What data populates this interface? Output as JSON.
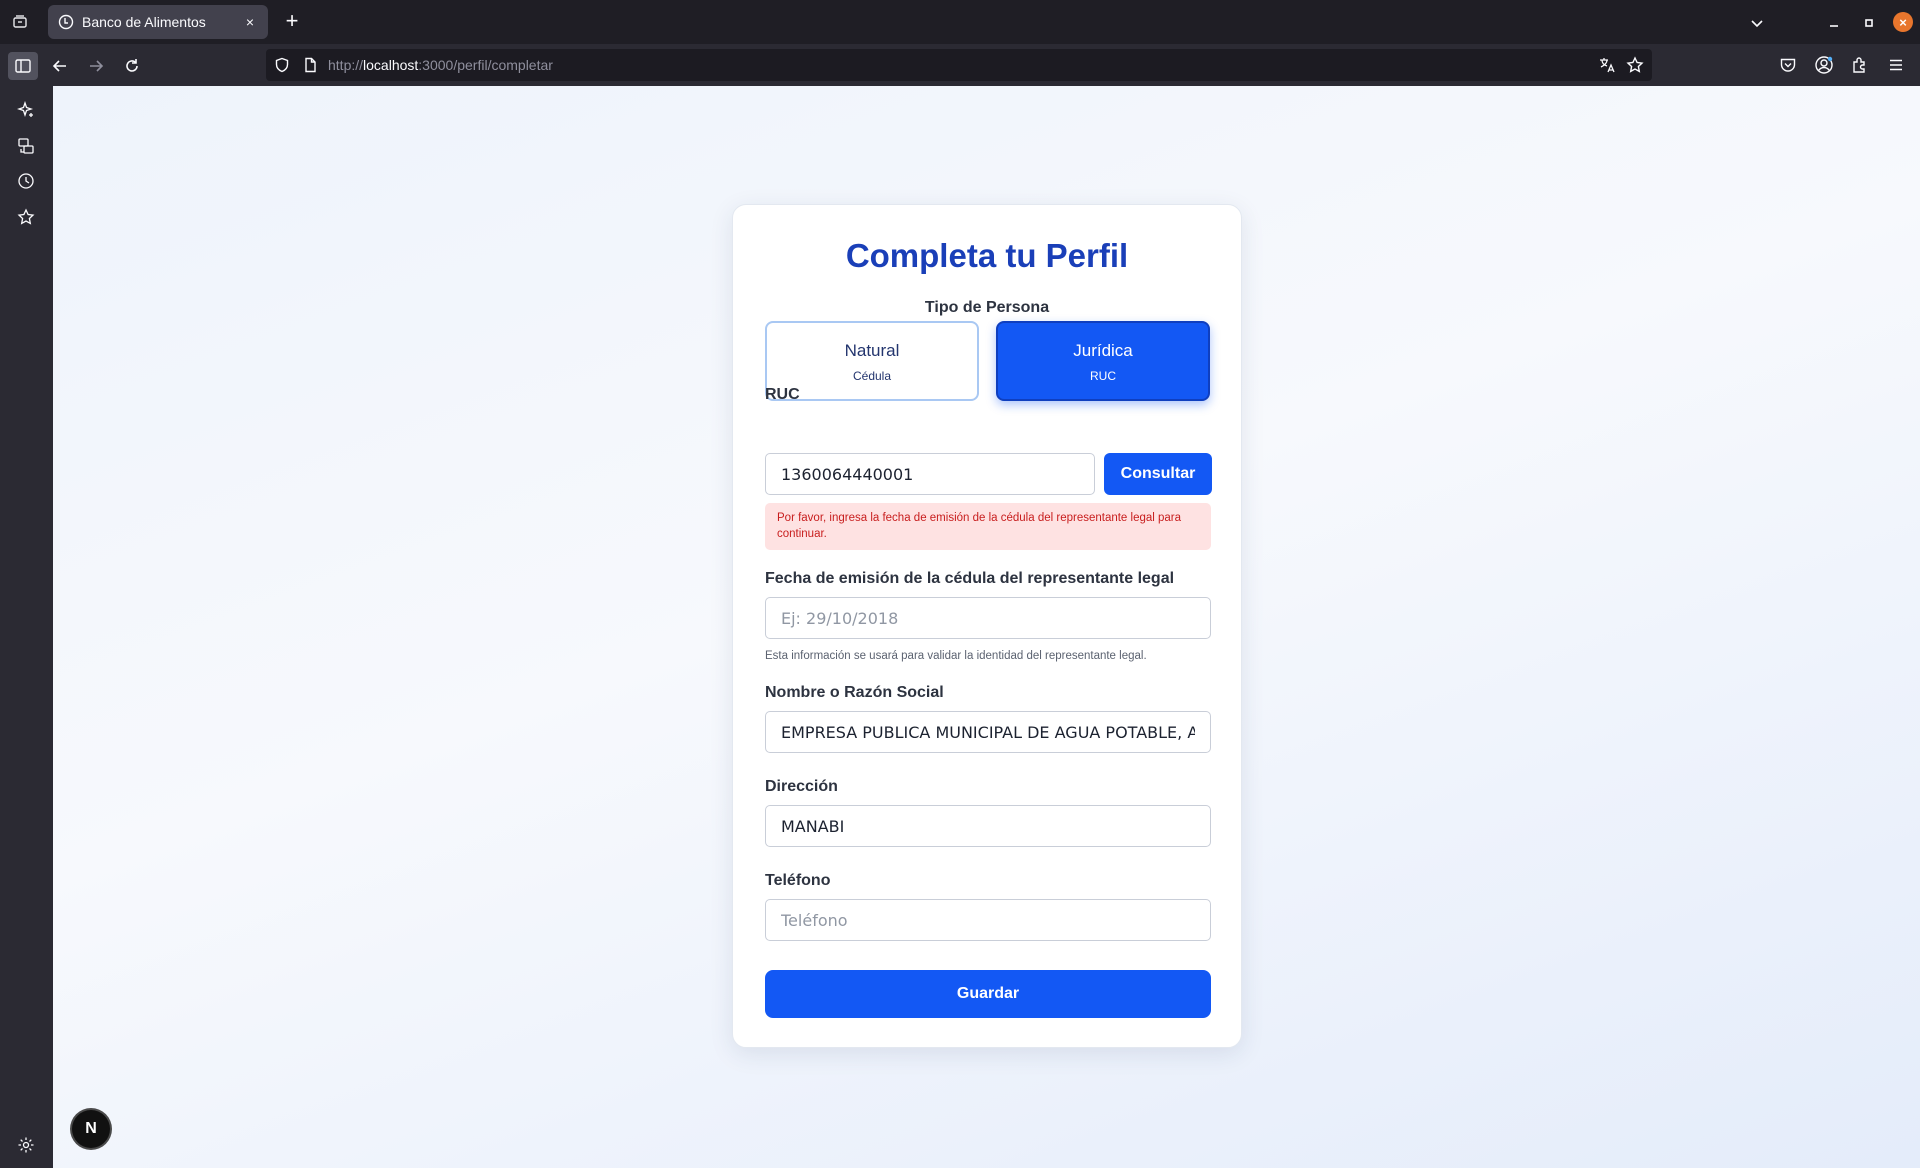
{
  "browser": {
    "tab_title": "Banco de Alimentos",
    "tab_close": "×",
    "new_tab": "+",
    "url_prefix": "http://",
    "url_host": "localhost",
    "url_path": ":3000/perfil/completar",
    "window_close": "×"
  },
  "form": {
    "title": "Completa tu Perfil",
    "tipo_label": "Tipo de Persona",
    "options": [
      {
        "name": "Natural",
        "sub": "Cédula",
        "selected": false
      },
      {
        "name": "Jurídica",
        "sub": "RUC",
        "selected": true
      }
    ],
    "ruc_label": "RUC",
    "ruc_value": "1360064440001",
    "consultar_label": "Consultar",
    "alert": "Por favor, ingresa la fecha de emisión de la cédula del representante legal para continuar.",
    "fecha_label": "Fecha de emisión de la cédula del representante legal",
    "fecha_placeholder": "Ej: 29/10/2018",
    "fecha_hint": "Esta información se usará para validar la identidad del representante legal.",
    "nombre_label": "Nombre o Razón Social",
    "nombre_value": "EMPRESA PUBLICA MUNICIPAL DE AGUA POTABLE, ALCANTARILLADO Y SANEAMIENTO",
    "direccion_label": "Dirección",
    "direccion_value": "MANABI",
    "telefono_label": "Teléfono",
    "telefono_placeholder": "Teléfono",
    "guardar_label": "Guardar"
  },
  "dev_badge": "N",
  "colors": {
    "accent": "#1358f4",
    "title": "#1a3fb8",
    "alert_bg": "#fee2e2",
    "alert_text": "#c81e1e"
  }
}
